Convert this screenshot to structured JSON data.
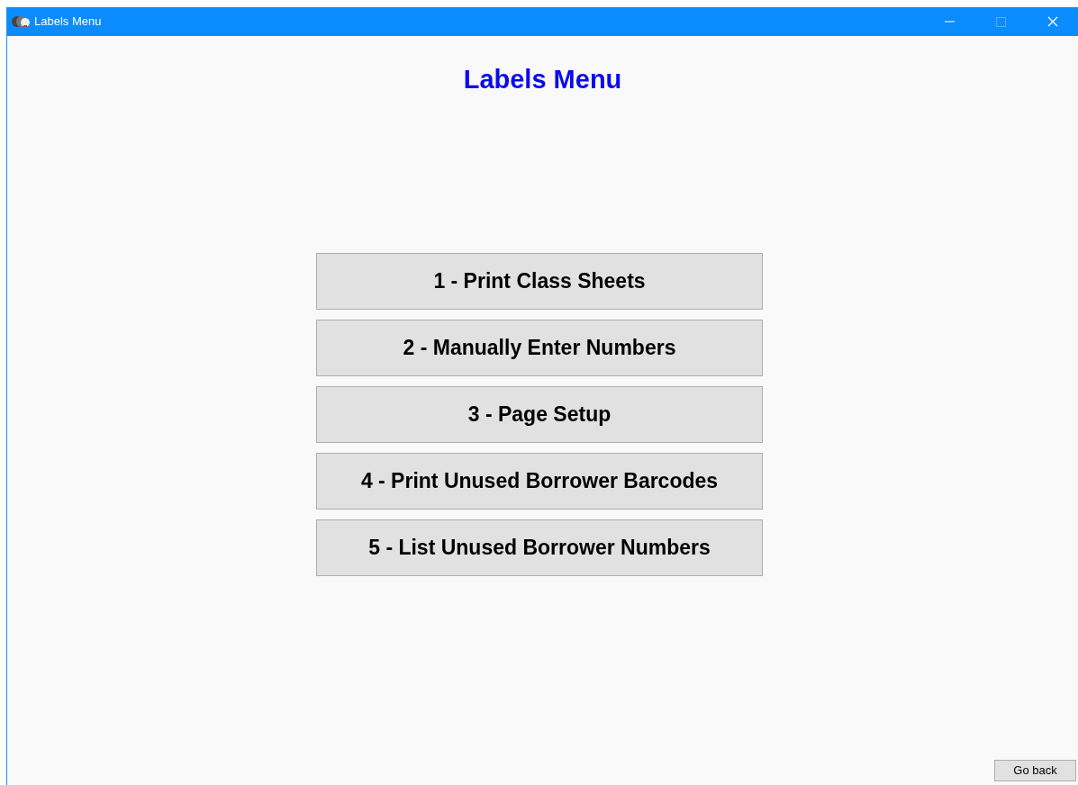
{
  "window": {
    "title": "Labels Menu",
    "controls": [
      {
        "kind": "minimize",
        "disabled": false
      },
      {
        "kind": "maximize",
        "disabled": true
      },
      {
        "kind": "close",
        "disabled": false
      }
    ]
  },
  "heading": "Labels Menu",
  "menu_buttons": [
    {
      "label": "1 - Print Class Sheets"
    },
    {
      "label": "2 - Manually Enter Numbers"
    },
    {
      "label": "3 - Page Setup"
    },
    {
      "label": "4 - Print Unused Borrower Barcodes"
    },
    {
      "label": "5 - List Unused Borrower Numbers"
    }
  ],
  "go_back_button": "Go back"
}
